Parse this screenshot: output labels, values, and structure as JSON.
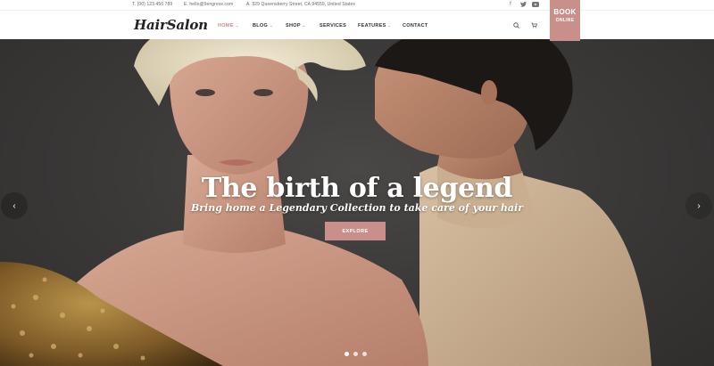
{
  "topbar": {
    "phone": "T. (00) 123 456 789",
    "email": "E. hello@9engress.com",
    "address": "A. 329 Queensberry Street, CA 94559, United States",
    "social": [
      "facebook-icon",
      "twitter-icon",
      "youtube-icon"
    ]
  },
  "brand": {
    "logo": "HairSalon"
  },
  "nav": {
    "items": [
      {
        "label": "HOME",
        "dropdown": true,
        "active": true
      },
      {
        "label": "BLOG",
        "dropdown": true
      },
      {
        "label": "SHOP",
        "dropdown": true
      },
      {
        "label": "SERVICES",
        "dropdown": false
      },
      {
        "label": "FEATURES",
        "dropdown": true
      },
      {
        "label": "CONTACT",
        "dropdown": false
      }
    ],
    "icons": [
      "search-icon",
      "cart-icon"
    ],
    "book": {
      "line1": "BOOK",
      "line2": "ONLINE"
    }
  },
  "hero": {
    "headline": "The birth of a legend",
    "subline": "Bring home a Legendary Collection to take care of your hair",
    "button": "EXPLORE",
    "slides": 3,
    "active_slide": 1
  },
  "colors": {
    "accent": "#c98f8b",
    "hero_bg": "#3c3a39",
    "text_dark": "#222222"
  }
}
